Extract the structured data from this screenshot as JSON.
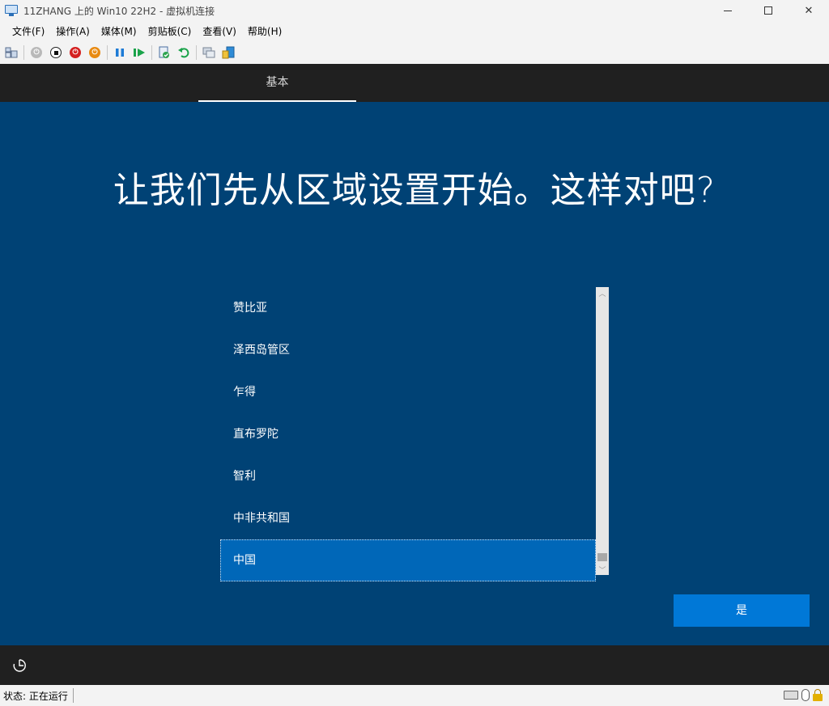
{
  "window": {
    "title": "11ZHANG 上的 Win10 22H2 - 虚拟机连接"
  },
  "menu": [
    "文件(F)",
    "操作(A)",
    "媒体(M)",
    "剪贴板(C)",
    "查看(V)",
    "帮助(H)"
  ],
  "oobe": {
    "tab_label": "基本",
    "heading": "让我们先从区域设置开始。这样对吧?",
    "regions": [
      "赞比亚",
      "泽西岛管区",
      "乍得",
      "直布罗陀",
      "智利",
      "中非共和国",
      "中国"
    ],
    "selected_region": "中国",
    "confirm_button": "是"
  },
  "status": {
    "text": "状态: 正在运行"
  },
  "colors": {
    "oobe_background": "#004275",
    "oobe_bar": "#202020",
    "selected_item": "#0067b8",
    "primary_button": "#0078d7"
  }
}
